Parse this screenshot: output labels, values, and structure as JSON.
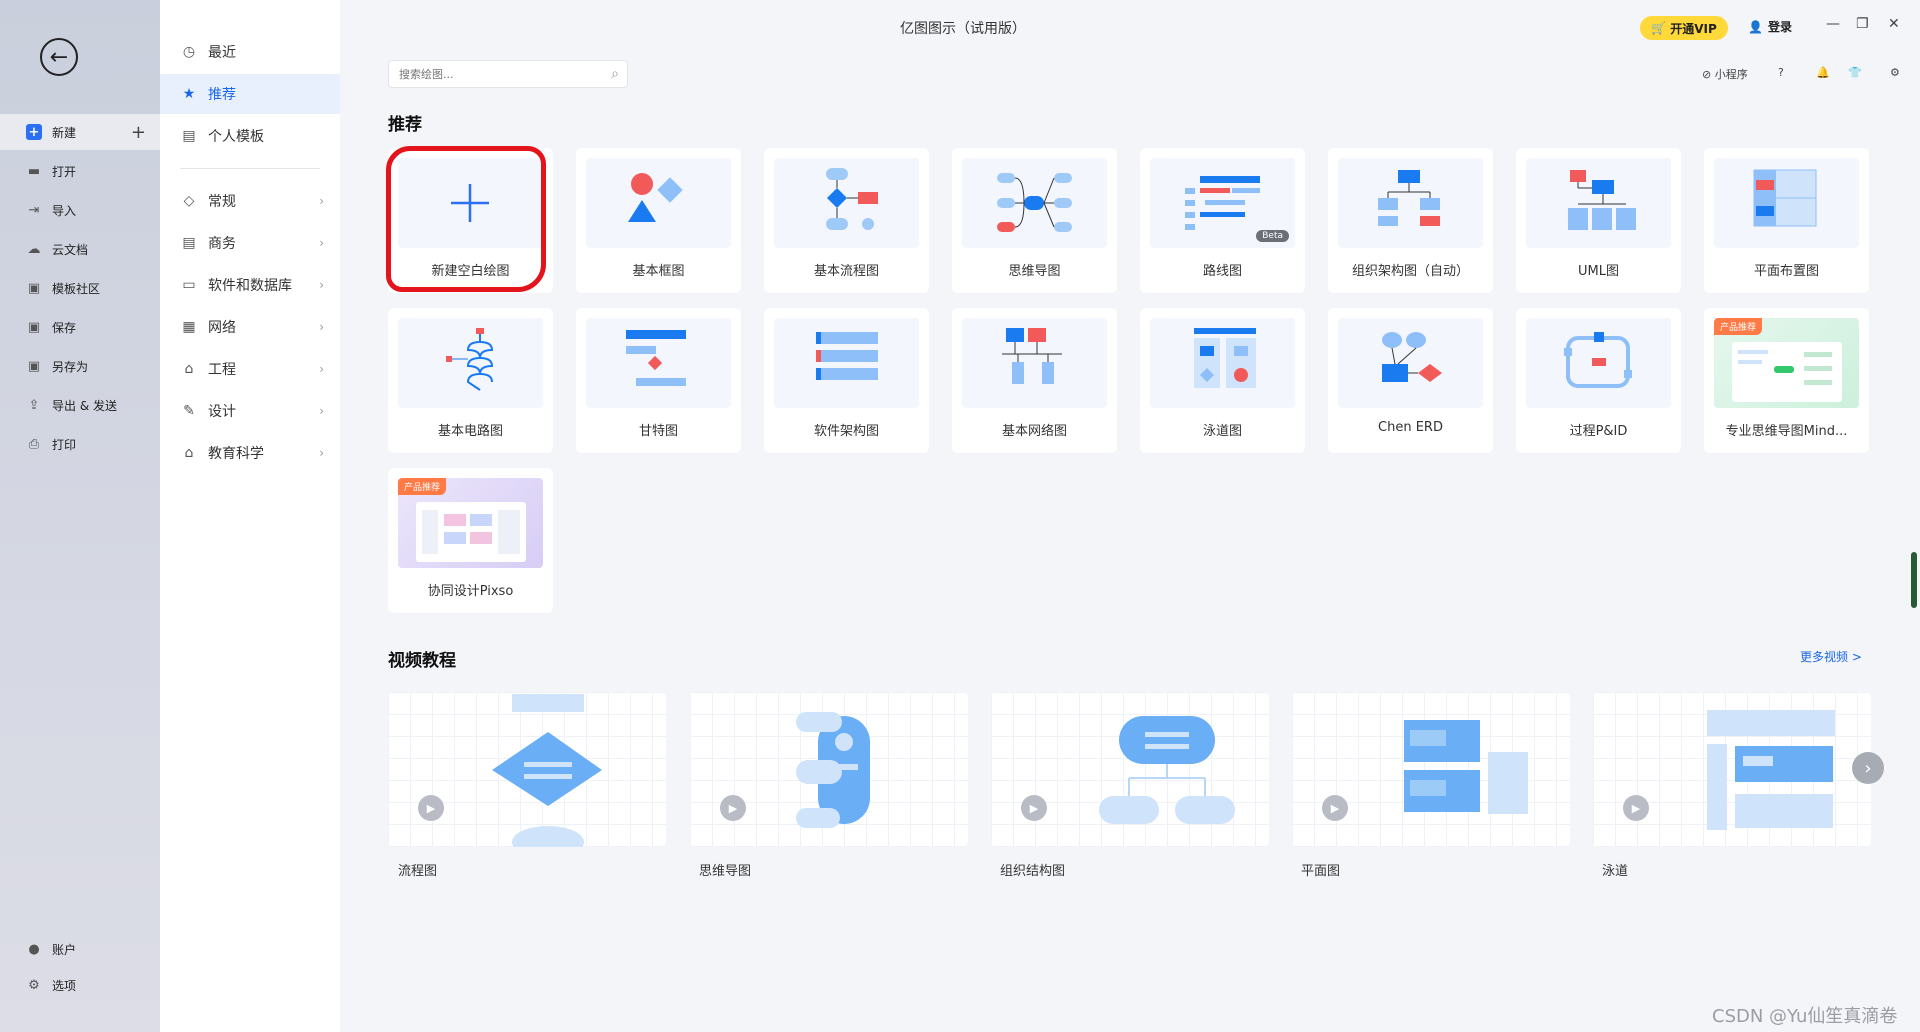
{
  "window": {
    "title": "亿图图示（试用版）",
    "vip_label": "开通VIP",
    "login_label": "登录",
    "minimize": "—",
    "restore": "❐",
    "close": "✕"
  },
  "left_nav": {
    "back": "←",
    "items": [
      {
        "label": "新建",
        "icon": "+"
      },
      {
        "label": "打开",
        "icon": "▬"
      },
      {
        "label": "导入",
        "icon": "⇥"
      },
      {
        "label": "云文档",
        "icon": "☁"
      },
      {
        "label": "模板社区",
        "icon": "▣"
      },
      {
        "label": "保存",
        "icon": "▣"
      },
      {
        "label": "另存为",
        "icon": "▣"
      },
      {
        "label": "导出 & 发送",
        "icon": "⇪"
      },
      {
        "label": "打印",
        "icon": "⎙"
      }
    ],
    "bottom_items": [
      {
        "label": "账户",
        "icon": "●"
      },
      {
        "label": "选项",
        "icon": "⚙"
      }
    ],
    "plus": "+"
  },
  "categories": {
    "top": [
      {
        "label": "最近",
        "icon": "◷"
      },
      {
        "label": "推荐",
        "icon": "★"
      },
      {
        "label": "个人模板",
        "icon": "▤"
      }
    ],
    "groups": [
      {
        "label": "常规",
        "icon": "◇"
      },
      {
        "label": "商务",
        "icon": "▤"
      },
      {
        "label": "软件和数据库",
        "icon": "▭"
      },
      {
        "label": "网络",
        "icon": "▦"
      },
      {
        "label": "工程",
        "icon": "⌂"
      },
      {
        "label": "设计",
        "icon": "✎"
      },
      {
        "label": "教育科学",
        "icon": "⌂"
      }
    ],
    "arrow": "›"
  },
  "search": {
    "placeholder": "搜索绘图...",
    "icon": "⌕"
  },
  "toolbar": {
    "mini_program": "小程序",
    "help": "?",
    "bell": "🔔",
    "shirt": "👕",
    "settings": "⚙"
  },
  "recommend": {
    "title": "推荐",
    "cards": [
      {
        "label": "新建空白绘图"
      },
      {
        "label": "基本框图"
      },
      {
        "label": "基本流程图"
      },
      {
        "label": "思维导图"
      },
      {
        "label": "路线图",
        "badge": "Beta"
      },
      {
        "label": "组织架构图（自动）"
      },
      {
        "label": "UML图"
      },
      {
        "label": "平面布置图"
      },
      {
        "label": "基本电路图"
      },
      {
        "label": "甘特图"
      },
      {
        "label": "软件架构图"
      },
      {
        "label": "基本网络图"
      },
      {
        "label": "泳道图"
      },
      {
        "label": "Chen ERD"
      },
      {
        "label": "过程P&ID"
      },
      {
        "label": "专业思维导图Mind...",
        "badge": "产品推荐"
      },
      {
        "label": "协同设计Pixso",
        "badge": "产品推荐"
      }
    ]
  },
  "videos": {
    "title": "视频教程",
    "more": "更多视频 >",
    "items": [
      {
        "label": "流程图"
      },
      {
        "label": "思维导图"
      },
      {
        "label": "组织结构图"
      },
      {
        "label": "平面图"
      },
      {
        "label": "泳道"
      }
    ],
    "play": "▶",
    "next": "›"
  },
  "watermark": "CSDN @Yu仙笙真滴卷"
}
